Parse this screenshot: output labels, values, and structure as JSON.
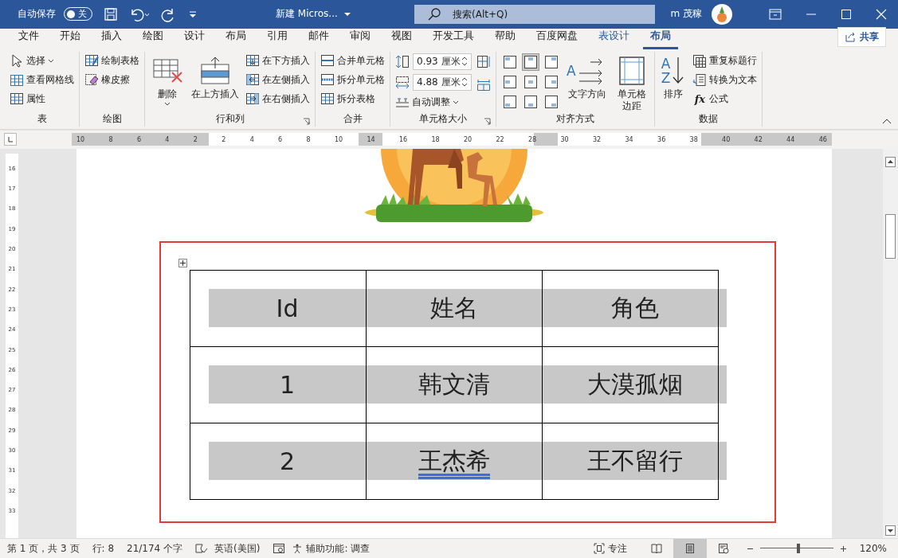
{
  "title_bar": {
    "autosave_label": "自动保存",
    "autosave_on": false,
    "autosave_state": "关",
    "document_title": "新建 Micros...",
    "search_placeholder": "搜索(Alt+Q)",
    "user_name": "m 茂稼"
  },
  "menu_tabs": [
    {
      "label": "文件",
      "selected": false,
      "kind": "normal"
    },
    {
      "label": "开始",
      "selected": false,
      "kind": "normal"
    },
    {
      "label": "插入",
      "selected": false,
      "kind": "normal"
    },
    {
      "label": "绘图",
      "selected": false,
      "kind": "normal"
    },
    {
      "label": "设计",
      "selected": false,
      "kind": "normal"
    },
    {
      "label": "布局",
      "selected": false,
      "kind": "normal"
    },
    {
      "label": "引用",
      "selected": false,
      "kind": "normal"
    },
    {
      "label": "邮件",
      "selected": false,
      "kind": "normal"
    },
    {
      "label": "审阅",
      "selected": false,
      "kind": "normal"
    },
    {
      "label": "视图",
      "selected": false,
      "kind": "normal"
    },
    {
      "label": "开发工具",
      "selected": false,
      "kind": "normal"
    },
    {
      "label": "帮助",
      "selected": false,
      "kind": "normal"
    },
    {
      "label": "百度网盘",
      "selected": false,
      "kind": "normal"
    },
    {
      "label": "表设计",
      "selected": false,
      "kind": "contextual"
    },
    {
      "label": "布局",
      "selected": true,
      "kind": "contextual"
    }
  ],
  "share_button": "共享",
  "ribbon_groups": [
    {
      "label": "表",
      "columns": [
        [
          {
            "kind": "small",
            "label": "选择",
            "dropdown": true
          },
          {
            "kind": "small",
            "label": "查看网格线"
          },
          {
            "kind": "small",
            "label": "属性"
          }
        ]
      ]
    },
    {
      "label": "绘图",
      "columns": [
        [
          {
            "kind": "small",
            "label": "绘制表格"
          },
          {
            "kind": "small",
            "label": "橡皮擦"
          }
        ]
      ]
    },
    {
      "label": "行和列",
      "launcher": true,
      "columns": [
        [
          {
            "kind": "large",
            "label_lines": [
              "删除"
            ],
            "dropdown": true
          }
        ],
        [
          {
            "kind": "large",
            "label_lines": [
              "在上方插入"
            ]
          }
        ],
        [
          {
            "kind": "small",
            "label": "在下方插入"
          },
          {
            "kind": "small",
            "label": "在左侧插入"
          },
          {
            "kind": "small",
            "label": "在右侧插入"
          }
        ]
      ]
    },
    {
      "label": "合并",
      "columns": [
        [
          {
            "kind": "small",
            "label": "合并单元格"
          },
          {
            "kind": "small",
            "label": "拆分单元格"
          },
          {
            "kind": "small",
            "label": "拆分表格"
          }
        ]
      ]
    },
    {
      "label": "单元格大小",
      "launcher": true,
      "columns": [
        [
          {
            "kind": "spin",
            "value": "0.93 厘米"
          },
          {
            "kind": "spin",
            "value": "4.88 厘米"
          },
          {
            "kind": "small",
            "label": "自动调整",
            "dropdown": true
          }
        ],
        [
          {
            "kind": "icon"
          },
          {
            "kind": "icon"
          }
        ]
      ]
    },
    {
      "label": "对齐方式",
      "columns": [
        [
          {
            "kind": "align",
            "cells": [
              {
                "selected": false
              },
              {
                "selected": true
              },
              {
                "selected": false
              },
              {
                "selected": false
              },
              {
                "selected": false
              },
              {
                "selected": false
              },
              {
                "selected": false
              },
              {
                "selected": false
              },
              {
                "selected": false
              }
            ]
          }
        ],
        [
          {
            "kind": "large",
            "label_lines": [
              "文字方向"
            ],
            "glyph": "A"
          }
        ],
        [
          {
            "kind": "large",
            "label_lines": [
              "单元格",
              "边距"
            ]
          }
        ]
      ]
    },
    {
      "label": "数据",
      "columns": [
        [
          {
            "kind": "large",
            "label_lines": [
              "排序"
            ],
            "glyph": "A\nZ"
          }
        ],
        [
          {
            "kind": "small",
            "label": "重复标题行"
          },
          {
            "kind": "small",
            "label": "转换为文本"
          },
          {
            "kind": "small",
            "label": "公式",
            "glyph": "fx"
          }
        ]
      ]
    }
  ],
  "ruler": {
    "labels": [
      "10",
      "8",
      "6",
      "4",
      "2",
      "2",
      "4",
      "6",
      "8",
      "10",
      "14",
      "16",
      "18",
      "20",
      "22",
      "28",
      "30",
      "32",
      "34",
      "36",
      "38",
      "40",
      "42",
      "44",
      "46"
    ]
  },
  "vertical_ruler": {
    "labels": [
      "16",
      "17",
      "18",
      "19",
      "20",
      "21",
      "22",
      "23",
      "24",
      "25",
      "26",
      "27",
      "28",
      "29",
      "30",
      "31",
      "32",
      "33"
    ]
  },
  "document": {
    "table": {
      "columns": [
        "Id",
        "姓名",
        "角色"
      ],
      "rows": [
        [
          {
            "text": "1",
            "flagged": false
          },
          {
            "text": "韩文清",
            "flagged": false
          },
          {
            "text": "大漠孤烟",
            "flagged": false
          }
        ],
        [
          {
            "text": "2",
            "flagged": false
          },
          {
            "text": "王杰希",
            "flagged": true
          },
          {
            "text": "王不留行",
            "flagged": false
          }
        ]
      ]
    }
  },
  "status_bar": {
    "page": "第 1 页，共 3 页",
    "line": "行: 8",
    "words": "21/174 个字",
    "language": "英语(美国)",
    "accessibility": "辅助功能: 调查",
    "focus": "专注",
    "views": [
      {
        "selected": false
      },
      {
        "selected": true
      },
      {
        "selected": false
      }
    ],
    "zoom_slider": {
      "level": 0.53
    },
    "zoom": "120%"
  }
}
